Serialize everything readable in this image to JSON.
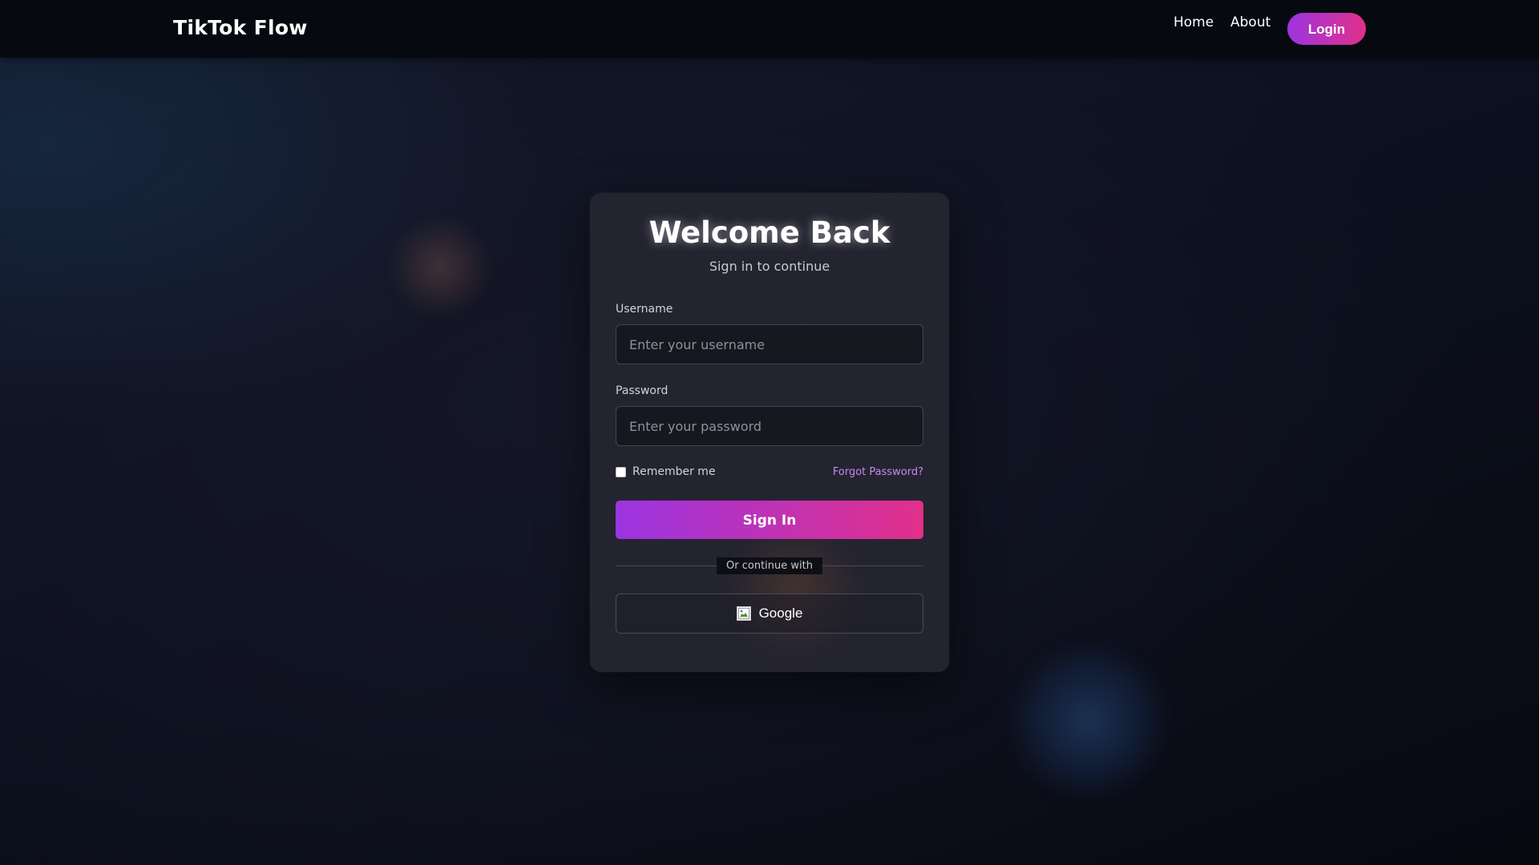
{
  "nav": {
    "brand": "TikTok Flow",
    "links": [
      {
        "label": "Home"
      },
      {
        "label": "About"
      }
    ],
    "login_label": "Login"
  },
  "card": {
    "title": "Welcome Back",
    "subtitle": "Sign in to continue",
    "username": {
      "label": "Username",
      "placeholder": "Enter your username",
      "value": ""
    },
    "password": {
      "label": "Password",
      "placeholder": "Enter your password",
      "value": ""
    },
    "remember_label": "Remember me",
    "remember_checked": false,
    "forgot_label": "Forgot Password?",
    "signin_label": "Sign In",
    "divider_label": "Or continue with",
    "google_label": "Google",
    "google_icon": "broken-image-icon"
  },
  "colors": {
    "accent_start": "#9b34e0",
    "accent_end": "#e1308a",
    "link": "#c58af0",
    "background": "#0c0f1b"
  }
}
